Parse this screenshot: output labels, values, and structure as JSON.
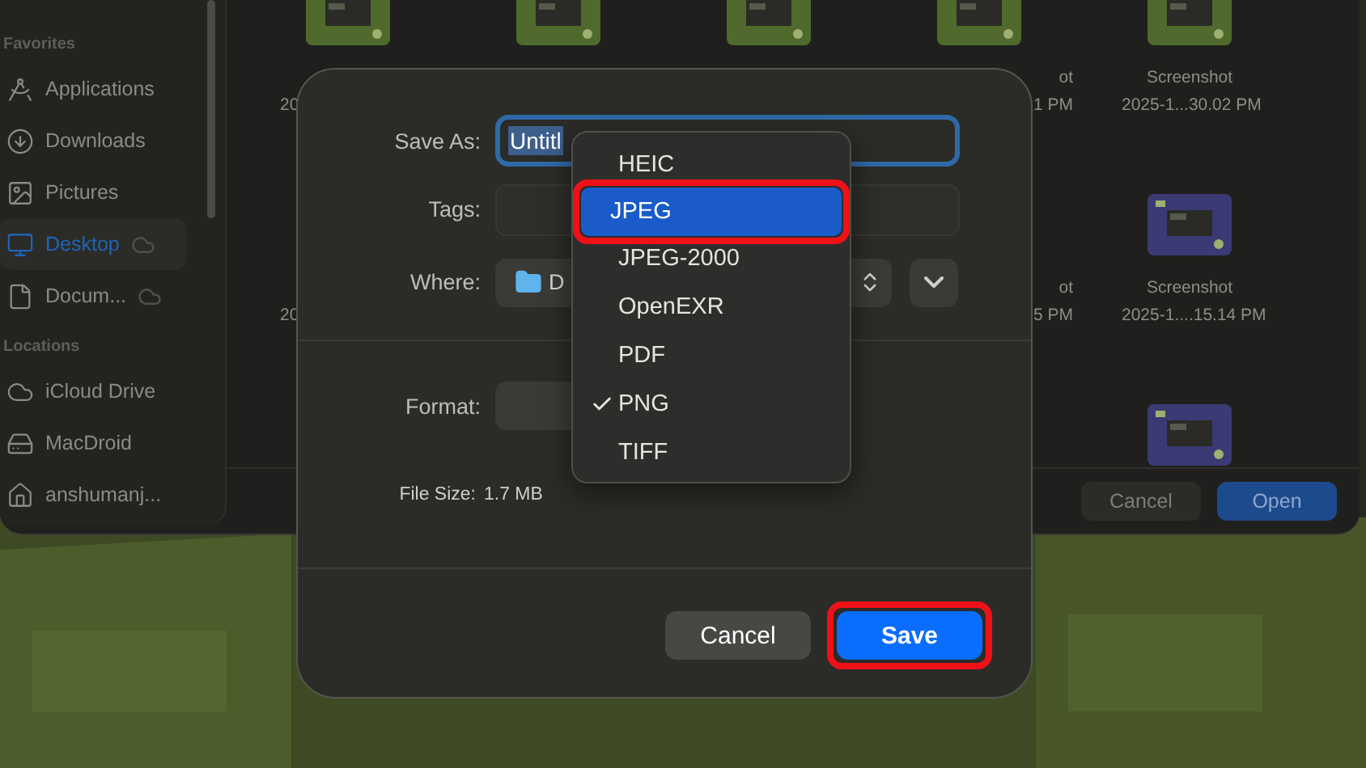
{
  "backdrop_window": {
    "sidebar": [
      {
        "title": "Favorites",
        "items": [
          {
            "label": "Applications",
            "kind": "applications",
            "selected": false,
            "cloud": false
          },
          {
            "label": "Downloads",
            "kind": "downloads",
            "selected": false,
            "cloud": false
          },
          {
            "label": "Pictures",
            "kind": "pictures",
            "selected": false,
            "cloud": false
          },
          {
            "label": "Desktop",
            "kind": "desktop",
            "selected": true,
            "cloud": true
          },
          {
            "label": "Docum...",
            "kind": "documents",
            "selected": false,
            "cloud": true
          }
        ]
      },
      {
        "title": "Locations",
        "items": [
          {
            "label": "iCloud Drive",
            "kind": "icloud",
            "selected": false,
            "cloud": false
          },
          {
            "label": "MacDroid",
            "kind": "drive",
            "selected": false,
            "cloud": false
          },
          {
            "label": "anshumanj...",
            "kind": "home",
            "selected": false,
            "cloud": false
          }
        ]
      }
    ],
    "file_rows": [
      [
        {
          "color": "#4f6a2c",
          "date": "20"
        },
        {
          "color": "#4f6a2c"
        },
        {
          "color": "#4f6a2c"
        },
        {
          "color": "#4f6a2c",
          "name": "ot",
          "date": "1 PM"
        },
        {
          "color": "#4f6a2c",
          "name": "Screenshot",
          "date": "2025-1...30.02 PM"
        }
      ],
      [
        {
          "date": "20"
        },
        {},
        {},
        {
          "name": "ot",
          "date": "5 PM"
        },
        {
          "color": "#3b3a74",
          "name": "Screenshot",
          "date": "2025-1....15.14 PM"
        }
      ],
      [
        {},
        {},
        {},
        {},
        {
          "color": "#3b3a74"
        }
      ]
    ],
    "buttons": [
      {
        "label": "Cancel",
        "kind": "secondary"
      },
      {
        "label": "Open",
        "kind": "primary"
      }
    ]
  },
  "dialog": {
    "save_as": {
      "label": "Save As:",
      "value": "Untitl"
    },
    "tags": {
      "label": "Tags:"
    },
    "where": {
      "label": "Where:",
      "value": "D"
    },
    "format": {
      "label": "Format:"
    },
    "file_size": {
      "label": "File Size:",
      "value": "1.7 MB"
    },
    "format_menu": [
      {
        "label": "HEIC",
        "selected": false,
        "checked": false,
        "highlighted": false
      },
      {
        "label": "JPEG",
        "selected": true,
        "checked": false,
        "highlighted": true
      },
      {
        "label": "JPEG-2000",
        "selected": false,
        "checked": false,
        "highlighted": false
      },
      {
        "label": "OpenEXR",
        "selected": false,
        "checked": false,
        "highlighted": false
      },
      {
        "label": "PDF",
        "selected": false,
        "checked": false,
        "highlighted": false
      },
      {
        "label": "PNG",
        "selected": false,
        "checked": true,
        "highlighted": false
      },
      {
        "label": "TIFF",
        "selected": false,
        "checked": false,
        "highlighted": false
      }
    ],
    "buttons": [
      {
        "label": "Cancel",
        "kind": "secondary",
        "highlighted": false
      },
      {
        "label": "Save",
        "kind": "primary",
        "highlighted": true
      }
    ]
  }
}
